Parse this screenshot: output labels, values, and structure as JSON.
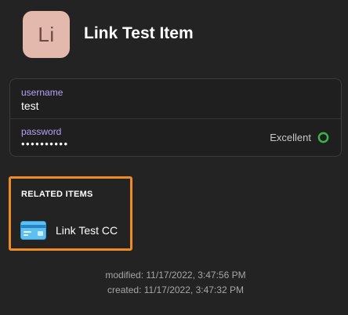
{
  "item": {
    "avatar_text": "Li",
    "title": "Link Test Item"
  },
  "fields": {
    "username": {
      "label": "username",
      "value": "test"
    },
    "password": {
      "label": "password",
      "value": "••••••••••",
      "strength_label": "Excellent",
      "strength_color": "#3bb54a"
    }
  },
  "related": {
    "header": "RELATED ITEMS",
    "items": [
      {
        "label": "Link Test CC",
        "icon": "credit-card-icon"
      }
    ],
    "highlight_color": "#f08a24"
  },
  "meta": {
    "modified": "modified: 11/17/2022, 3:47:56 PM",
    "created": "created: 11/17/2022, 3:47:32 PM"
  },
  "colors": {
    "background": "#232323",
    "label_accent": "#b9a2f5",
    "avatar_bg": "#e3b9ae"
  }
}
